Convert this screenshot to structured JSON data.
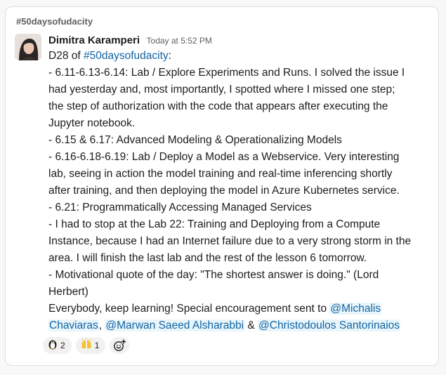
{
  "channel": {
    "name": "#50daysofudacity"
  },
  "message": {
    "author": "Dimitra Karamperi",
    "timestamp": "Today at 5:52 PM",
    "intro_prefix": "D28 of ",
    "intro_hashtag": "#50daysofudacity",
    "intro_suffix": ":",
    "lines": [
      "- 6.11-6.13-6.14: Lab / Explore Experiments and Runs. I solved the issue I",
      "had yesterday and, most importantly, I spotted where I missed one step;",
      "the step of authorization with the code that appears after executing the",
      "Jupyter notebook.",
      "- 6.15 & 6.17: Advanced Modeling & Operationalizing Models",
      "- 6.16-6.18-6.19: Lab / Deploy a Model as a Webservice. Very interesting",
      "lab, seeing in action the model training and real-time inferencing shortly",
      "after training, and then deploying the model in Azure Kubernetes service.",
      "- 6.21: Programmatically Accessing Managed Services",
      "- I had to stop at the Lab 22: Training and Deploying from a Compute",
      "Instance, because I had an Internet failure due to a very strong storm in the",
      "area. I will finish the last lab and the rest of the lesson 6 tomorrow.",
      "- Motivational quote of the day: \"The shortest answer is doing.\" (Lord",
      "Herbert)"
    ],
    "closing_text": "Everybody, keep learning! Special encouragement sent to ",
    "mention_1_part1": "@Michalis",
    "mention_1_part2": "Chaviaras",
    "separator_1": ", ",
    "mention_2": "@Marwan Saeed Alsharabbi",
    "separator_2": " & ",
    "mention_3": "@Christodoulos Santorinaios"
  },
  "reactions": [
    {
      "icon": "penguin-emoji-icon",
      "count": "2"
    },
    {
      "icon": "raised-hands-emoji-icon",
      "count": "1"
    }
  ],
  "colors": {
    "link": "#1264a3",
    "mention_bg": "#e8f5fa",
    "text": "#1d1c1d",
    "muted": "#616061"
  }
}
